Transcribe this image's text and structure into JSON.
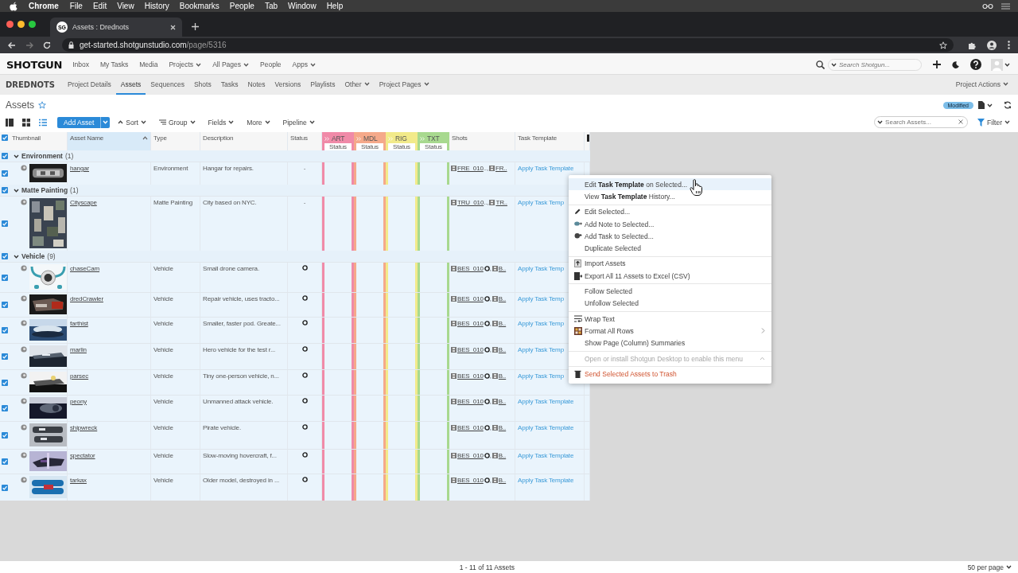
{
  "mac_menubar": {
    "app_name": "Chrome",
    "items": [
      "File",
      "Edit",
      "View",
      "History",
      "Bookmarks",
      "People",
      "Tab",
      "Window",
      "Help"
    ]
  },
  "browser": {
    "tab": {
      "favicon": "SG",
      "title": "Assets : Drednots",
      "selected": true
    },
    "url_host": "get-started.shotgunstudio.com",
    "url_path": "/page/5316"
  },
  "global_nav": {
    "logo": "SHOTGUN",
    "items": [
      {
        "label": "Inbox",
        "dropdown": false
      },
      {
        "label": "My Tasks",
        "dropdown": false
      },
      {
        "label": "Media",
        "dropdown": false
      },
      {
        "label": "Projects",
        "dropdown": true
      },
      {
        "label": "All Pages",
        "dropdown": true
      },
      {
        "label": "People",
        "dropdown": false
      },
      {
        "label": "Apps",
        "dropdown": true
      }
    ],
    "search": {
      "placeholder": "Search Shotgun..."
    }
  },
  "project_nav": {
    "project": "DREDNOTS",
    "items": [
      {
        "label": "Project Details",
        "selected": false,
        "dropdown": false
      },
      {
        "label": "Assets",
        "selected": true,
        "dropdown": false
      },
      {
        "label": "Sequences",
        "selected": false,
        "dropdown": false
      },
      {
        "label": "Shots",
        "selected": false,
        "dropdown": false
      },
      {
        "label": "Tasks",
        "selected": false,
        "dropdown": false
      },
      {
        "label": "Notes",
        "selected": false,
        "dropdown": false
      },
      {
        "label": "Versions",
        "selected": false,
        "dropdown": false
      },
      {
        "label": "Playlists",
        "selected": false,
        "dropdown": false
      },
      {
        "label": "Other",
        "selected": false,
        "dropdown": true
      },
      {
        "label": "Project Pages",
        "selected": false,
        "dropdown": true
      }
    ],
    "actions": "Project Actions"
  },
  "page": {
    "title": "Assets",
    "badge": "Modified"
  },
  "toolbar": {
    "views": [
      {
        "kind": "detail",
        "selected": false
      },
      {
        "kind": "grid",
        "selected": false
      },
      {
        "kind": "list",
        "selected": true
      }
    ],
    "add_button": "Add Asset",
    "menus": [
      {
        "label": "Sort",
        "kind": "sort"
      },
      {
        "label": "Group",
        "kind": "group"
      },
      {
        "label": "Fields",
        "kind": "plain"
      },
      {
        "label": "More",
        "kind": "plain"
      },
      {
        "label": "Pipeline",
        "kind": "plain"
      }
    ],
    "search": {
      "placeholder": "Search Assets..."
    },
    "filter": "Filter"
  },
  "table": {
    "all_checked": true,
    "columns": [
      "Thumbnail",
      "Asset Name",
      "Type",
      "Description",
      "Status"
    ],
    "steps": [
      {
        "label": "ART",
        "sub": "Status",
        "color": "#f08aa8"
      },
      {
        "label": "MDL",
        "sub": "Status",
        "color": "#f5a98a"
      },
      {
        "label": "RIG",
        "sub": "Status",
        "color": "#f2ea8a"
      },
      {
        "label": "TXT",
        "sub": "Status",
        "color": "#a8d98f"
      }
    ],
    "columns_after": [
      "Shots",
      "Task Template"
    ],
    "groups": [
      {
        "label": "Environment",
        "count": "(1)",
        "expanded": true,
        "checked": true,
        "rows": [
          {
            "name": "hangar",
            "type": "Environment",
            "description": "Hangar for repairs.",
            "status": {
              "kind": "text",
              "text": "-"
            },
            "shots": [
              {
                "code": "FRE_010",
                "trail": "..,",
                "pending": false
              },
              {
                "code": "FR..",
                "pending": false
              }
            ],
            "task_template": "Apply Task Template",
            "checked": true,
            "selected": true
          }
        ]
      },
      {
        "label": "Matte Painting",
        "count": "(1)",
        "expanded": true,
        "checked": true,
        "rows": [
          {
            "name": "Cityscape",
            "type": "Matte Painting",
            "description": "City based on NYC.",
            "status": {
              "kind": "text",
              "text": "-"
            },
            "shots": [
              {
                "code": "TRU_010",
                "trail": "..,",
                "pending": false
              },
              {
                "code": "TR..",
                "pending": false
              }
            ],
            "task_template": "Apply Task Temp",
            "checked": true,
            "selected": true
          }
        ]
      },
      {
        "label": "Vehicle",
        "count": "(9)",
        "expanded": true,
        "checked": true,
        "rows": [
          {
            "name": "chaseCam",
            "type": "Vehicle",
            "description": "Small drone camera.",
            "status": {
              "kind": "pending"
            },
            "shots": [
              {
                "code": "BES_010",
                "trail": ",",
                "pending": true
              },
              {
                "code": "B..",
                "pending": false
              }
            ],
            "task_template": "Apply Task Temp",
            "checked": true,
            "selected": true
          },
          {
            "name": "dredCrawler",
            "type": "Vehicle",
            "description": "Repair vehicle, uses tracto...",
            "status": {
              "kind": "pending"
            },
            "shots": [
              {
                "code": "BES_010",
                "trail": ",",
                "pending": true
              },
              {
                "code": "B..",
                "pending": false
              }
            ],
            "task_template": "Apply Task Temp",
            "checked": true,
            "selected": true
          },
          {
            "name": "farthist",
            "type": "Vehicle",
            "description": "Smaller, faster pod. Greate...",
            "status": {
              "kind": "pending"
            },
            "shots": [
              {
                "code": "BES_010",
                "trail": ",",
                "pending": true
              },
              {
                "code": "B..",
                "pending": false
              }
            ],
            "task_template": "Apply Task Temp",
            "checked": true,
            "selected": true
          },
          {
            "name": "marlin",
            "type": "Vehicle",
            "description": "Hero vehicle for the test r...",
            "status": {
              "kind": "pending"
            },
            "shots": [
              {
                "code": "BES_010",
                "trail": ",",
                "pending": true
              },
              {
                "code": "B..",
                "pending": false
              }
            ],
            "task_template": "Apply Task Temp",
            "checked": true,
            "selected": true
          },
          {
            "name": "parsec",
            "type": "Vehicle",
            "description": "Tiny one-person vehicle, n...",
            "status": {
              "kind": "pending"
            },
            "shots": [
              {
                "code": "BES_010",
                "trail": ",",
                "pending": true
              },
              {
                "code": "B..",
                "pending": false
              }
            ],
            "task_template": "Apply Task Temp",
            "checked": true,
            "selected": true
          },
          {
            "name": "peony",
            "type": "Vehicle",
            "description": "Unmanned attack vehicle.",
            "status": {
              "kind": "pending"
            },
            "shots": [
              {
                "code": "BES_010",
                "trail": ",",
                "pending": true
              },
              {
                "code": "B..",
                "pending": false
              }
            ],
            "task_template": "Apply Task Template",
            "checked": true,
            "selected": true
          },
          {
            "name": "shipwreck",
            "type": "Vehicle",
            "description": "Pirate vehicle.",
            "status": {
              "kind": "pending"
            },
            "shots": [
              {
                "code": "BES_010",
                "trail": ",",
                "pending": true
              },
              {
                "code": "B..",
                "pending": false
              }
            ],
            "task_template": "Apply Task Template",
            "checked": true,
            "selected": true
          },
          {
            "name": "spectator",
            "type": "Vehicle",
            "description": "Slow-moving hovercraft, f...",
            "status": {
              "kind": "pending"
            },
            "shots": [
              {
                "code": "BES_010",
                "trail": ",",
                "pending": true
              },
              {
                "code": "B..",
                "pending": false
              }
            ],
            "task_template": "Apply Task Template",
            "checked": true,
            "selected": true
          },
          {
            "name": "tarkax",
            "type": "Vehicle",
            "description": "Older model, destroyed in ...",
            "status": {
              "kind": "pending"
            },
            "shots": [
              {
                "code": "BES_010",
                "trail": ",",
                "pending": true
              },
              {
                "code": "B..",
                "pending": false
              }
            ],
            "task_template": "Apply Task Template",
            "checked": true,
            "selected": true
          }
        ]
      }
    ]
  },
  "context_menu": {
    "sections": [
      [
        {
          "label": "Edit **Task Template** on Selected...",
          "kind": "plain",
          "selected": true
        },
        {
          "label": "View **Task Template** History...",
          "kind": "plain",
          "selected": false
        }
      ],
      [
        {
          "label": "Edit Selected...",
          "kind": "pencil",
          "selected": false
        },
        {
          "label": "Add Note to Selected...",
          "kind": "note",
          "selected": false
        },
        {
          "label": "Add Task to Selected...",
          "kind": "task",
          "selected": false
        },
        {
          "label": "Duplicate Selected",
          "kind": "plain",
          "selected": false
        }
      ],
      [
        {
          "label": "Import Assets",
          "kind": "import",
          "selected": false
        },
        {
          "label": "Export All 11 Assets to Excel (CSV)",
          "kind": "export",
          "selected": false
        }
      ],
      [
        {
          "label": "Follow Selected",
          "kind": "plain",
          "selected": false
        },
        {
          "label": "Unfollow Selected",
          "kind": "plain",
          "selected": false
        }
      ],
      [
        {
          "label": "Wrap Text",
          "kind": "wrap",
          "selected": false
        },
        {
          "label": "Format All Rows",
          "kind": "format",
          "selected": false,
          "submenu": true
        },
        {
          "label": "Show Page (Column) Summaries",
          "kind": "plain",
          "selected": false
        }
      ],
      [
        {
          "label": "Open or install Shotgun Desktop to enable this menu",
          "kind": "plain",
          "selected": false,
          "disabled": true
        }
      ],
      [
        {
          "label": "Send Selected Assets to Trash",
          "kind": "trash",
          "selected": false,
          "danger": true
        }
      ]
    ]
  },
  "footer": {
    "count": "1 - 11 of 11 Assets",
    "per_page": "50 per page"
  }
}
